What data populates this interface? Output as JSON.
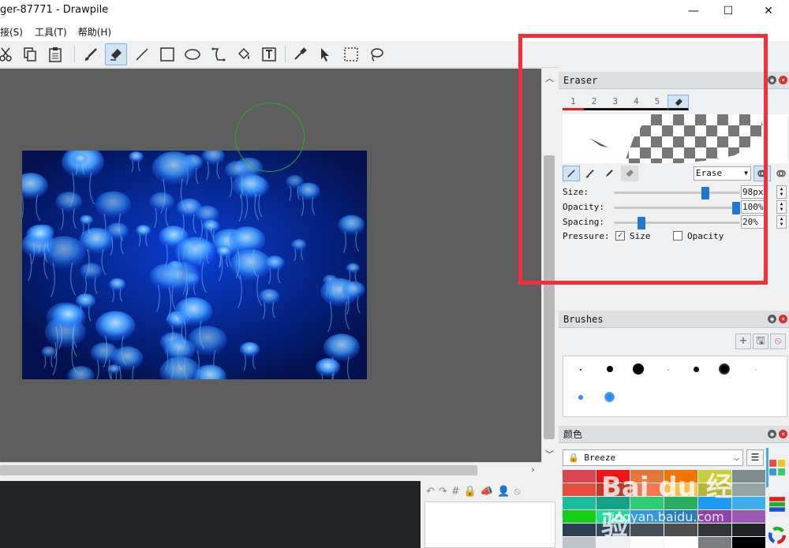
{
  "window": {
    "title": "ger-87771 - Drawpile",
    "minimize": "—",
    "maximize": "☐",
    "close": "✕"
  },
  "menu": [
    "接(S)",
    "工具(T)",
    "帮助(H)"
  ],
  "eraser_panel": {
    "title": "Eraser",
    "slots": [
      "1",
      "2",
      "3",
      "4",
      "5"
    ],
    "blend_mode": "Erase",
    "size": {
      "label": "Size:",
      "value": "98px",
      "fraction": 0.74
    },
    "opacity": {
      "label": "Opacity:",
      "value": "100%",
      "fraction": 1.0
    },
    "spacing": {
      "label": "Spacing:",
      "value": "20%",
      "fraction": 0.2
    },
    "pressure": {
      "label": "Pressure:",
      "size_label": "Size",
      "size_checked": true,
      "opacity_label": "Opacity",
      "opacity_checked": false
    }
  },
  "brushes_panel": {
    "title": "Brushes",
    "add": "+",
    "save": "🖫",
    "delete": "⦸"
  },
  "color_panel": {
    "title": "颜色",
    "palette": "Breeze",
    "menu": "☰",
    "swatches": [
      "#da4453",
      "#ed1515",
      "#e8763b",
      "#f67400",
      "#c9ce3b",
      "#7f8c8d",
      "#e74c3c",
      "#c0392b",
      "#f47750",
      "#fdbc4b",
      "#b7b53b",
      "#95a5a6",
      "#1abc9c",
      "#16a085",
      "#2ecc71",
      "#27ae60",
      "#1d99f3",
      "#3daee9",
      "#11d116",
      "#1cdc9a",
      "#3498db",
      "#2980b9",
      "#8e44ad",
      "#9b59b6",
      "#2c3e50",
      "#34495e",
      "#475057",
      "#4d4d4d",
      "#31363b",
      "#232629",
      "#bdc3c7",
      "#eff0f1",
      "#fcfcfc",
      "#ffffff",
      "#7a7c7d",
      "#000000"
    ]
  },
  "watermark": {
    "main": "Bai du 经验",
    "sub": "jingyan.baidu.com"
  }
}
